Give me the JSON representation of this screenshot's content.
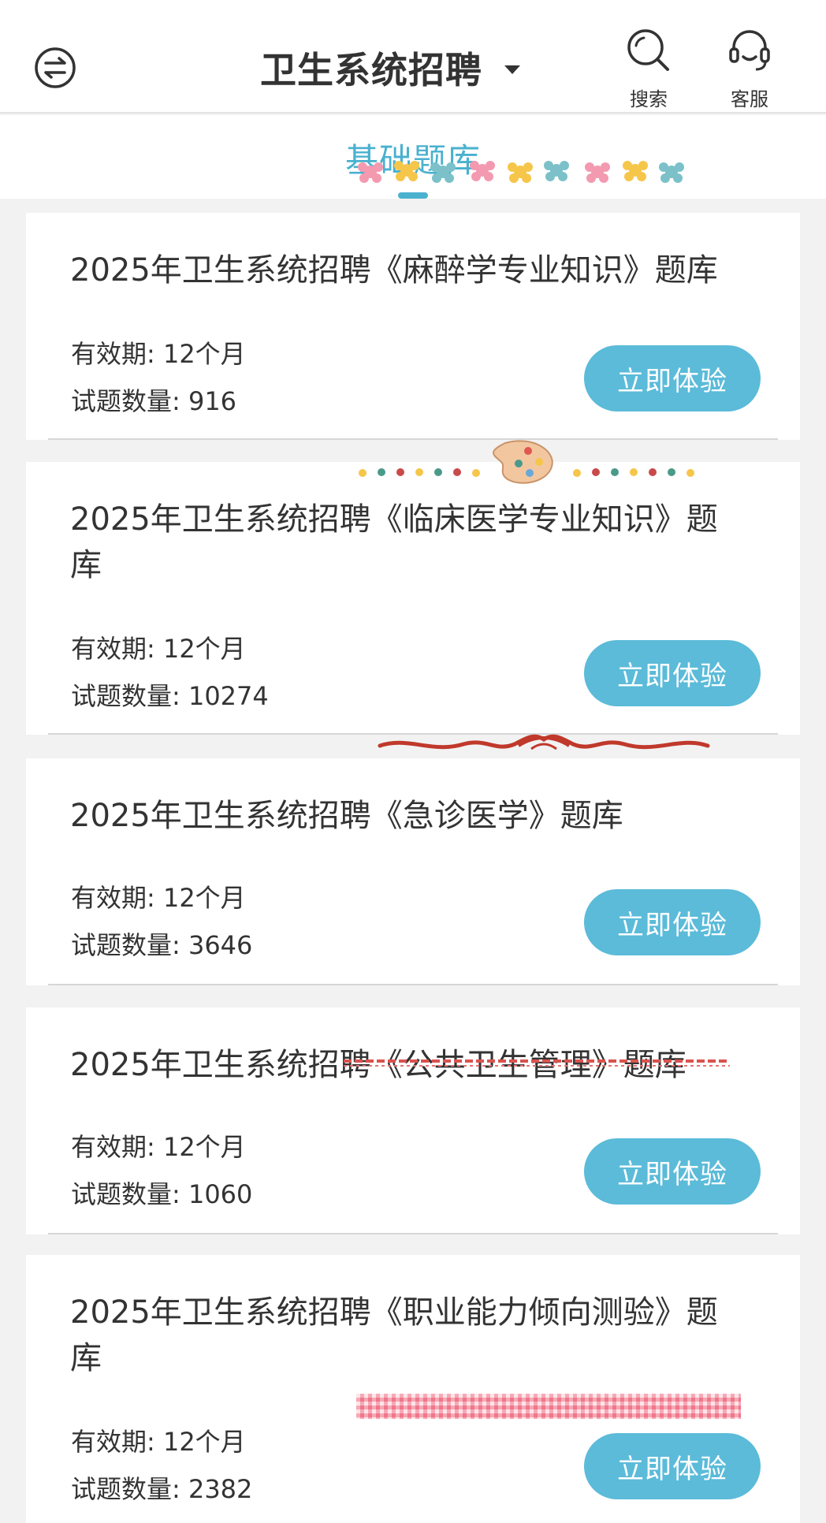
{
  "header": {
    "title": "卫生系统招聘",
    "search_label": "搜索",
    "service_label": "客服"
  },
  "tabs": {
    "active_label": "基础题库"
  },
  "colors": {
    "accent": "#4ab1cf",
    "button": "#5bbbd9",
    "text": "#333333",
    "background": "#f2f2f2"
  },
  "cards": [
    {
      "title": "2025年卫生系统招聘《麻醉学专业知识》题库",
      "validity": "有效期: 12个月",
      "count": "试题数量: 916",
      "button": "立即体验"
    },
    {
      "title": "2025年卫生系统招聘《临床医学专业知识》题库",
      "validity": "有效期: 12个月",
      "count": "试题数量: 10274",
      "button": "立即体验"
    },
    {
      "title": "2025年卫生系统招聘《急诊医学》题库",
      "validity": "有效期: 12个月",
      "count": "试题数量: 3646",
      "button": "立即体验"
    },
    {
      "title": "2025年卫生系统招聘《公共卫生管理》题库",
      "validity": "有效期: 12个月",
      "count": "试题数量: 1060",
      "button": "立即体验"
    },
    {
      "title": "2025年卫生系统招聘《职业能力倾向测验》题库",
      "validity": "有效期: 12个月",
      "count": "试题数量: 2382",
      "button": "立即体验"
    }
  ]
}
